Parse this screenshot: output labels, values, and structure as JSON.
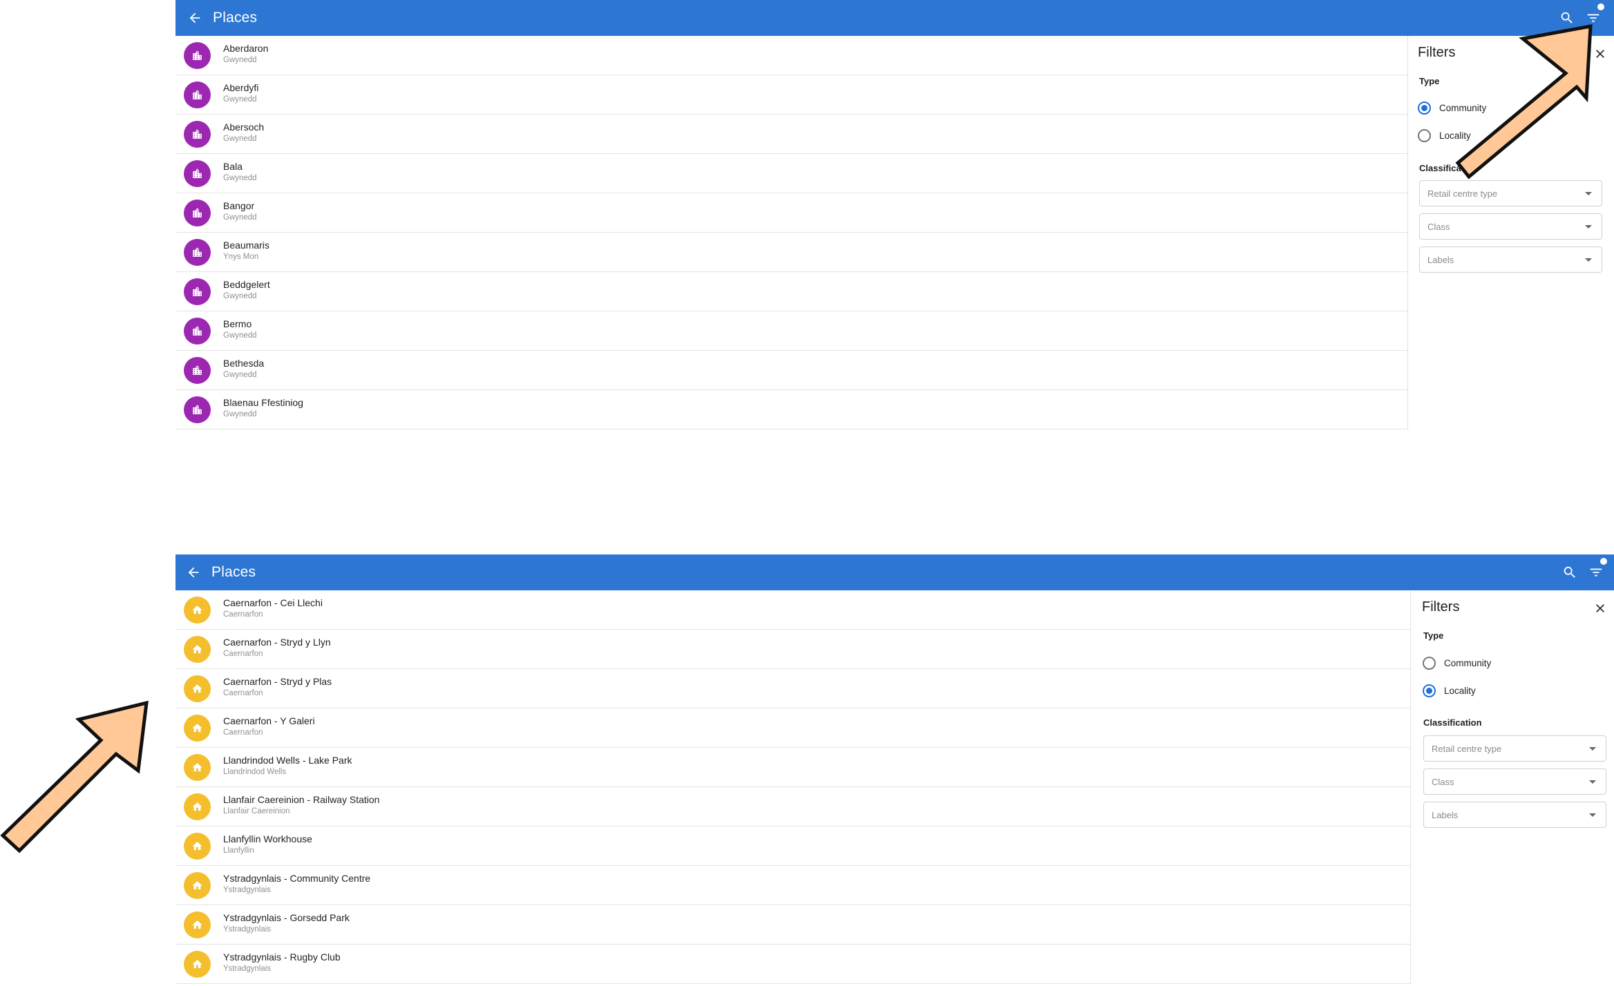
{
  "screens": [
    {
      "appbar": {
        "title": "Places",
        "back_icon": "arrow-back-icon",
        "search_icon": "search-icon",
        "filter_icon": "filter-list-icon"
      },
      "place_icon": "city-icon",
      "accent": "#9c27b0",
      "places": [
        {
          "name": "Aberdaron",
          "area": "Gwynedd"
        },
        {
          "name": "Aberdyfi",
          "area": "Gwynedd"
        },
        {
          "name": "Abersoch",
          "area": "Gwynedd"
        },
        {
          "name": "Bala",
          "area": "Gwynedd"
        },
        {
          "name": "Bangor",
          "area": "Gwynedd"
        },
        {
          "name": "Beaumaris",
          "area": "Ynys Mon"
        },
        {
          "name": "Beddgelert",
          "area": "Gwynedd"
        },
        {
          "name": "Bermo",
          "area": "Gwynedd"
        },
        {
          "name": "Bethesda",
          "area": "Gwynedd"
        },
        {
          "name": "Blaenau Ffestiniog",
          "area": "Gwynedd"
        }
      ],
      "filters": {
        "title": "Filters",
        "type_label": "Type",
        "options": [
          {
            "label": "Community",
            "selected": true
          },
          {
            "label": "Locality",
            "selected": false
          }
        ],
        "classification_label": "Classification",
        "selects": [
          {
            "value": "Retail centre type"
          },
          {
            "value": "Class"
          },
          {
            "value": "Labels"
          }
        ]
      }
    },
    {
      "appbar": {
        "title": "Places",
        "back_icon": "arrow-back-icon",
        "search_icon": "search-icon",
        "filter_icon": "filter-list-icon"
      },
      "place_icon": "home-icon",
      "accent": "#f4be2c",
      "places": [
        {
          "name": "Caernarfon - Cei Llechi",
          "area": "Caernarfon"
        },
        {
          "name": "Caernarfon - Stryd y Llyn",
          "area": "Caernarfon"
        },
        {
          "name": "Caernarfon - Stryd y Plas",
          "area": "Caernarfon"
        },
        {
          "name": "Caernarfon - Y Galeri",
          "area": "Caernarfon"
        },
        {
          "name": "Llandrindod Wells - Lake Park",
          "area": "Llandrindod Wells"
        },
        {
          "name": "Llanfair Caereinion - Railway Station",
          "area": "Llanfair Caereinion"
        },
        {
          "name": "Llanfyllin Workhouse",
          "area": "Llanfyllin"
        },
        {
          "name": "Ystradgynlais - Community Centre",
          "area": "Ystradgynlais"
        },
        {
          "name": "Ystradgynlais - Gorsedd Park",
          "area": "Ystradgynlais"
        },
        {
          "name": "Ystradgynlais - Rugby Club",
          "area": "Ystradgynlais"
        }
      ],
      "filters": {
        "title": "Filters",
        "type_label": "Type",
        "options": [
          {
            "label": "Community",
            "selected": false
          },
          {
            "label": "Locality",
            "selected": true
          }
        ],
        "classification_label": "Classification",
        "selects": [
          {
            "value": "Retail centre type"
          },
          {
            "value": "Class"
          },
          {
            "value": "Labels"
          }
        ]
      }
    }
  ],
  "annotation_color": "#ffc896"
}
